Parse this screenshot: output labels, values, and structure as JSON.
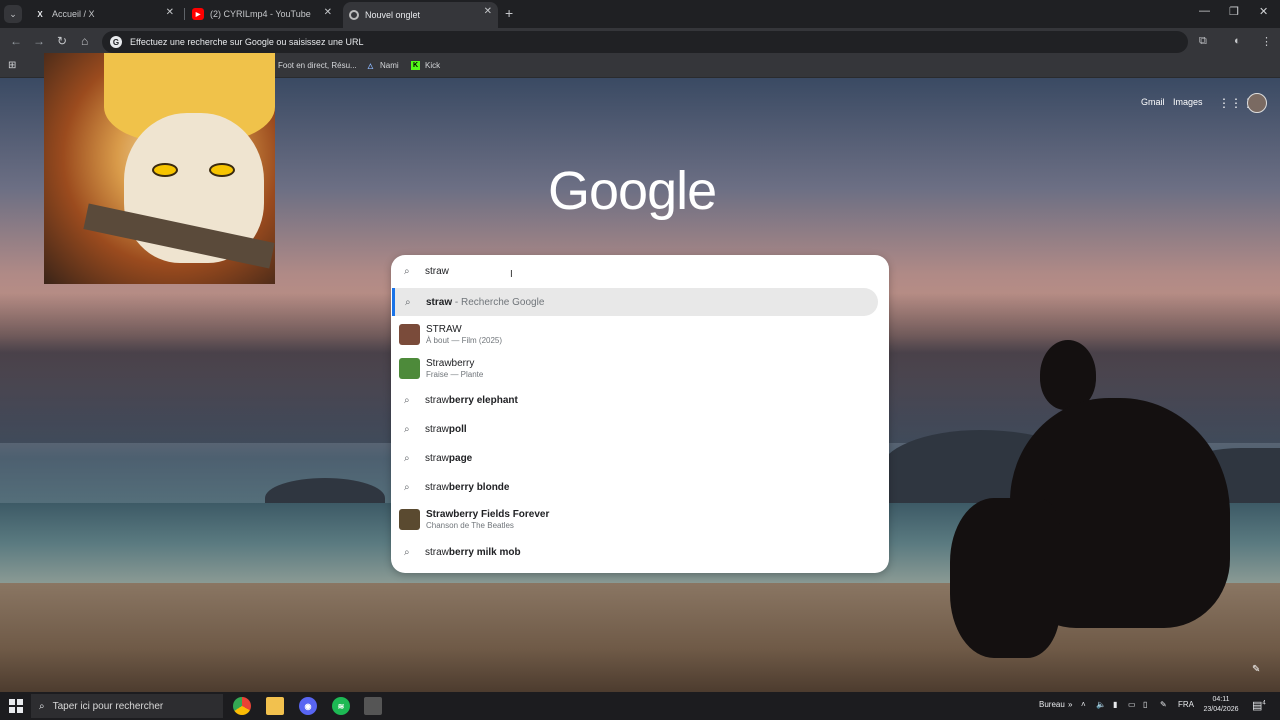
{
  "browser": {
    "tabs": [
      {
        "title": "Accueil / X",
        "icon": "x-logo-icon"
      },
      {
        "title": "(2) CYRILmp4 - YouTube",
        "icon": "youtube-icon"
      },
      {
        "title": "Nouvel onglet",
        "icon": "chrome-icon",
        "active": true
      }
    ],
    "new_tab_symbol": "+",
    "omnibox_placeholder": "Effectuez une recherche sur Google ou saisissez une URL",
    "bookmarks": [
      {
        "label": "Foot en direct, Résu...",
        "icon": "bookmark-icon"
      },
      {
        "label": "Nami",
        "icon": "triangle-icon"
      },
      {
        "label": "Kick",
        "icon": "kick-icon"
      }
    ]
  },
  "ntp": {
    "gmail_label": "Gmail",
    "images_label": "Images",
    "logo": "Google"
  },
  "search": {
    "query": "straw",
    "suggestions": [
      {
        "type": "search",
        "bold": "straw",
        "suffix": " - Recherche Google",
        "selected": true
      },
      {
        "type": "entity",
        "title": "STRAW",
        "subtitle": "À bout — Film (2025)",
        "thumb_color": "#7a4b3a"
      },
      {
        "type": "entity",
        "title": "Strawberry",
        "subtitle": "Fraise — Plante",
        "thumb_color": "#4d8a3a"
      },
      {
        "type": "search",
        "prefix": "straw",
        "bold": "berry elephant"
      },
      {
        "type": "search",
        "prefix": "straw",
        "bold": "poll"
      },
      {
        "type": "search",
        "prefix": "straw",
        "bold": "page"
      },
      {
        "type": "search",
        "prefix": "straw",
        "bold": "berry blonde"
      },
      {
        "type": "entity",
        "title": "Strawberry Fields Forever",
        "subtitle": "Chanson de The Beatles",
        "thumb_color": "#5a4a30"
      },
      {
        "type": "search",
        "prefix": "straw",
        "bold": "berry milk mob"
      }
    ]
  },
  "taskbar": {
    "search_placeholder": "Taper ici pour rechercher",
    "bureau_label": "Bureau",
    "language": "FRA",
    "time": "04:11",
    "date": "23/04/2026",
    "notification_count": "4"
  }
}
